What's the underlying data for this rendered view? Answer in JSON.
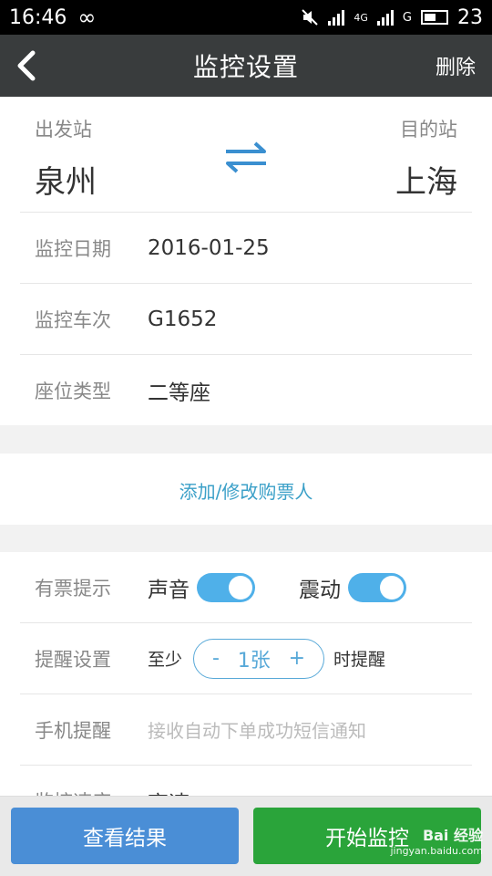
{
  "status": {
    "time": "16:46",
    "infinity": "∞",
    "network": "4G",
    "network2": "G",
    "battery": "23"
  },
  "header": {
    "title": "监控设置",
    "delete_label": "删除"
  },
  "stations": {
    "from_label": "出发站",
    "from": "泉州",
    "to_label": "目的站",
    "to": "上海"
  },
  "fields": [
    {
      "label": "监控日期",
      "value": "2016-01-25"
    },
    {
      "label": "监控车次",
      "value": "G1652"
    },
    {
      "label": "座位类型",
      "value": "二等座"
    }
  ],
  "passenger": {
    "link": "添加/修改购票人"
  },
  "alerts": {
    "ticket_label": "有票提示",
    "sound_label": "声音",
    "sound_on": true,
    "vibrate_label": "震动",
    "vibrate_on": true,
    "reminder_label": "提醒设置",
    "reminder_prefix": "至少",
    "reminder_minus": "-",
    "reminder_value": "1张",
    "reminder_plus": "+",
    "reminder_suffix": "时提醒",
    "phone_label": "手机提醒",
    "phone_hint": "接收自动下单成功短信通知",
    "speed_label": "监控速度",
    "speed_value": "高速"
  },
  "buttons": {
    "results": "查看结果",
    "start": "开始监控"
  },
  "watermark": {
    "text": "Bai 经验",
    "url": "jingyan.baidu.com"
  },
  "colors": {
    "header_bg": "#393c3d",
    "accent_blue": "#4fb0e9",
    "results_btn": "#4a8ed6",
    "start_btn": "#2aa43a",
    "link": "#3ba0c8"
  }
}
